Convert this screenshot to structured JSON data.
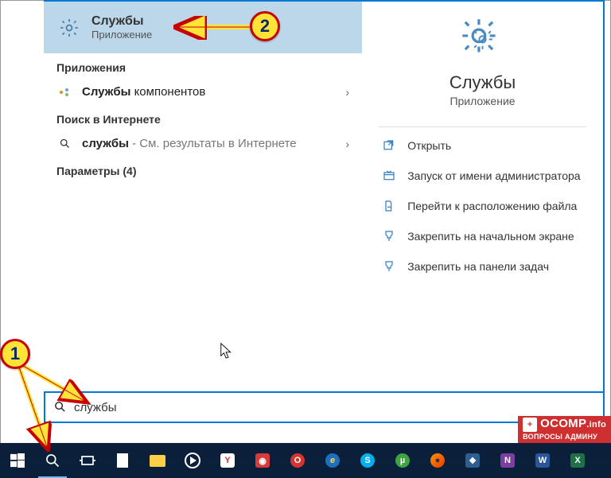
{
  "best_match": {
    "title": "Службы",
    "subtitle": "Приложение"
  },
  "sections": {
    "apps_header": "Приложения",
    "app_result_bold": "Службы",
    "app_result_rest": " компонентов",
    "web_header": "Поиск в Интернете",
    "web_result_bold": "службы",
    "web_result_rest": " - См. результаты в Интернете",
    "params_header": "Параметры (4)"
  },
  "detail": {
    "title": "Службы",
    "subtitle": "Приложение",
    "actions": [
      "Открыть",
      "Запуск от имени администратора",
      "Перейти к расположению файла",
      "Закрепить на начальном экране",
      "Закрепить на панели задач"
    ]
  },
  "search_value": "службы",
  "callouts": {
    "one": "1",
    "two": "2"
  },
  "watermark": {
    "brand": "OCOMP",
    "tld": ".info",
    "tagline": "ВОПРОСЫ АДМИНУ"
  }
}
